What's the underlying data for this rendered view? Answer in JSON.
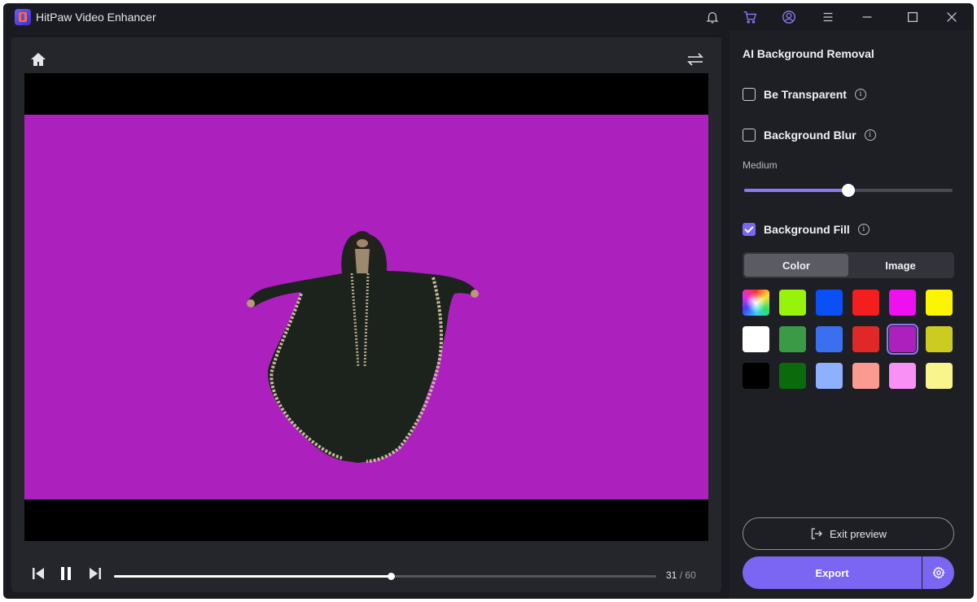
{
  "app": {
    "title": "HitPaw Video Enhancer"
  },
  "titlebar": {
    "icons": [
      "bell-icon",
      "cart-icon",
      "user-account-icon",
      "menu-icon",
      "minimize-icon",
      "maximize-icon",
      "close-icon"
    ],
    "cart_color": "#7a66f2"
  },
  "preview": {
    "background_fill_color": "#ac20be",
    "playback": {
      "current_frame": "31",
      "separator": "/",
      "total_frames": "60",
      "progress": 0.51
    }
  },
  "panel": {
    "title": "AI Background Removal",
    "options": [
      {
        "label": "Be Transparent",
        "checked": false
      },
      {
        "label": "Background Blur",
        "checked": false
      },
      {
        "label": "Background Fill",
        "checked": true
      }
    ],
    "blur": {
      "level_label": "Medium",
      "value": 0.5
    },
    "fill_tabs": [
      {
        "label": "Color",
        "active": true
      },
      {
        "label": "Image",
        "active": false
      }
    ],
    "swatches": [
      "rainbow",
      "#97f20c",
      "#0a50f5",
      "#f51e1e",
      "#ee10ee",
      "#fbf503",
      "#ffffff",
      "#3a9a45",
      "#3a70f0",
      "#e02828",
      "#ac20be",
      "#cbcb22",
      "#000000",
      "#0b6a0b",
      "#8fb0ff",
      "#fa9a90",
      "#f890f5",
      "#f9f48c"
    ],
    "selected_swatch": 10,
    "exit_preview_label": "Exit preview",
    "export_label": "Export"
  },
  "colors": {
    "accent": "#7a66f2",
    "window_bg": "#1a1b20",
    "panel_bg": "#1e1f24"
  }
}
